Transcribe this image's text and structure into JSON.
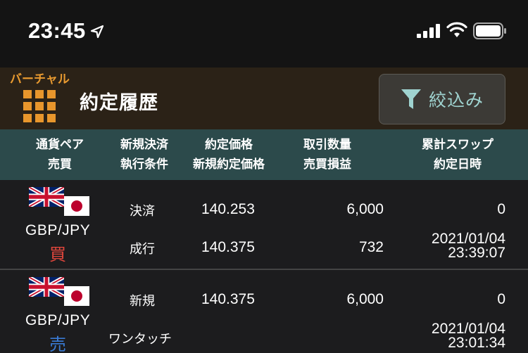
{
  "status_bar": {
    "time": "23:45",
    "icons": [
      "location-arrow-icon",
      "signal-icon",
      "wifi-icon",
      "battery-icon"
    ]
  },
  "header": {
    "mode_label": "バーチャル",
    "title": "約定履歴",
    "filter_label": "絞込み",
    "menu_icon": "grid-menu-icon",
    "filter_icon": "funnel-icon"
  },
  "columns": {
    "c1_line1": "通貨ペア",
    "c1_line2": "売買",
    "c2_line1": "新規決済",
    "c2_line2": "執行条件",
    "c3_line1": "約定価格",
    "c3_line2": "新規約定価格",
    "c4_line1": "取引数量",
    "c4_line2": "売買損益",
    "c5_line1": "累計スワップ",
    "c5_line2": "約定日時"
  },
  "rows": [
    {
      "pair": "GBP/JPY",
      "side": "買",
      "type": "決済",
      "exec": "成行",
      "price": "140.253",
      "open_price": "140.375",
      "quantity": "6,000",
      "pl": "732",
      "swap": "0",
      "date": "2021/01/04",
      "time": "23:39:07"
    },
    {
      "pair": "GBP/JPY",
      "side": "売",
      "type": "新規",
      "exec": "ワンタッチ",
      "price": "140.375",
      "open_price": "",
      "quantity": "6,000",
      "pl": "",
      "swap": "0",
      "date": "2021/01/04",
      "time": "23:01:34"
    }
  ],
  "colors": {
    "accent_orange": "#e8962c",
    "header_bg": "#2b2217",
    "column_header_bg": "#2c4a4b",
    "buy": "#e0463c",
    "sell": "#3a7bd5",
    "filter_text": "#9fd3d0"
  }
}
